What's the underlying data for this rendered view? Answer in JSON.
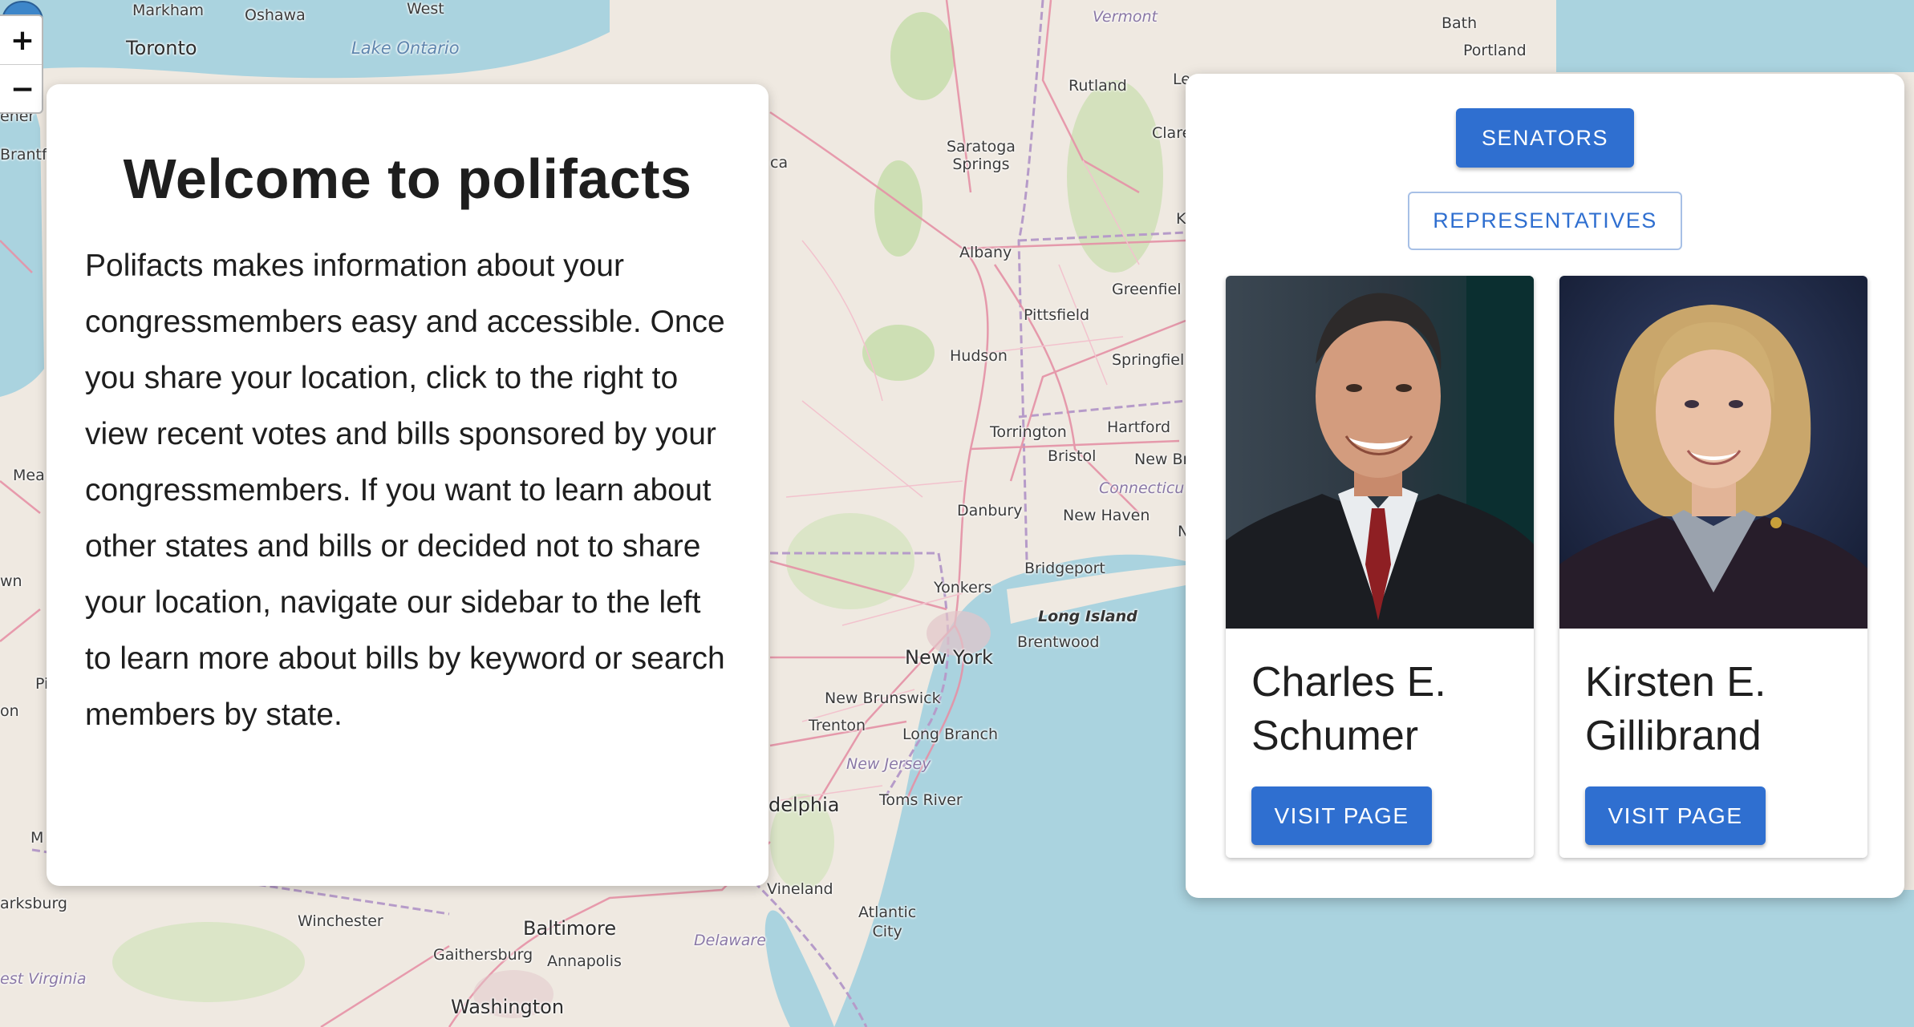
{
  "map": {
    "zoom_in": "+",
    "zoom_out": "−",
    "labels": {
      "markham": "Markham",
      "oshawa": "Oshawa",
      "west": "West",
      "toronto": "Toronto",
      "lake_ontario": "Lake Ontario",
      "vermont": "Vermont",
      "bath": "Bath",
      "portland": "Portland",
      "rutland": "Rutland",
      "le": "Le",
      "clare": "Clare",
      "saratoga": "Saratoga\nSprings",
      "albany": "Albany",
      "greenfield": "Greenfiel",
      "pittsfield": "Pittsfield",
      "hudson": "Hudson",
      "springfield": "Springfiel",
      "torrington": "Torrington",
      "hartford": "Hartford",
      "bristol": "Bristol",
      "new_britain": "New Br",
      "connecticut": "Connecticu",
      "danbury": "Danbury",
      "new_haven": "New Haven",
      "bridgeport": "Bridgeport",
      "yonkers": "Yonkers",
      "long_island": "Long Island",
      "brentwood": "Brentwood",
      "new_york": "New York",
      "new_brunswick": "New Brunswick",
      "trenton": "Trenton",
      "long_branch": "Long Branch",
      "new_jersey": "New Jersey",
      "delphia": "delphia",
      "toms_river": "Toms River",
      "vineland": "Vineland",
      "atlantic_city": "Atlantic\nCity",
      "winchester": "Winchester",
      "baltimore": "Baltimore",
      "gaithersburg": "Gaithersburg",
      "annapolis": "Annapolis",
      "washington": "Washington",
      "delaware": "Delaware",
      "west_virginia": "est Virginia",
      "arksburg": "arksburg",
      "brantf": "Brantf",
      "ener": "ener",
      "mea": "Mea",
      "wn": "wn",
      "pi": "Pi",
      "on": "on",
      "m": "M",
      "ca": "ca",
      "k": "K",
      "n": "N"
    }
  },
  "welcome": {
    "title": "Welcome to polifacts",
    "body": "Polifacts makes information about your congressmembers easy and accessible. Once you share your location, click to the right to view recent votes and bills sponsored by your congressmembers. If you want to learn about other states and bills or decided not to share your location, navigate our sidebar to the left to learn more about bills by keyword or search members by state."
  },
  "panel": {
    "senators_label": "SENATORS",
    "representatives_label": "REPRESENTATIVES",
    "members": [
      {
        "name": "Charles E. Schumer",
        "button": "VISIT PAGE"
      },
      {
        "name": "Kirsten E. Gillibrand",
        "button": "VISIT PAGE"
      }
    ]
  },
  "colors": {
    "accent": "#2f6fd0",
    "water": "#aad3df",
    "land": "#efe9e1",
    "forest": "#cddfb4",
    "road": "#e591a6"
  }
}
